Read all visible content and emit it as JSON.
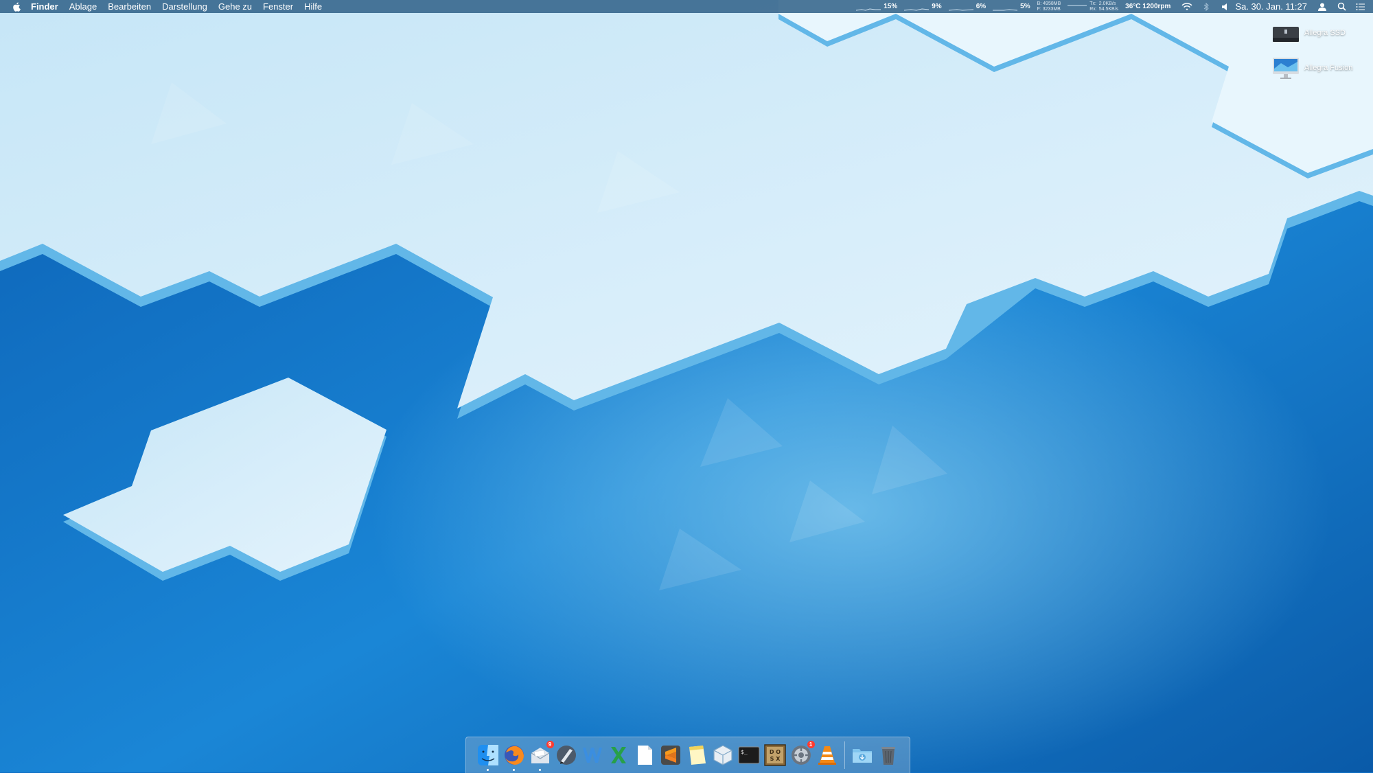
{
  "menubar": {
    "app_name": "Finder",
    "items": [
      "Ablage",
      "Bearbeiten",
      "Darstellung",
      "Gehe zu",
      "Fenster",
      "Hilfe"
    ],
    "status": {
      "cpu1": "15%",
      "cpu2": "9%",
      "gpu": "6%",
      "disk": "5%",
      "memory_lines": [
        "B: 4958MB",
        "F: 3233MB"
      ],
      "network_labels": [
        "Tx:",
        "Rx:"
      ],
      "network_values": [
        "2.0KB/s",
        "54.5KB/s"
      ],
      "temp_fan": "36°C 1200rpm",
      "clock": "Sa. 30. Jan.  11:27"
    }
  },
  "desktop_icons": [
    {
      "label": "Allegra SSD",
      "icon": "hard-drive-icon"
    },
    {
      "label": "Allegra Fusion",
      "icon": "imac-icon"
    }
  ],
  "dock": {
    "apps": [
      {
        "name": "finder",
        "icon": "finder-icon",
        "running": true
      },
      {
        "name": "firefox",
        "icon": "firefox-icon",
        "running": true
      },
      {
        "name": "mail",
        "icon": "mail-icon",
        "running": true,
        "badge": "9"
      },
      {
        "name": "pages",
        "icon": "pen-icon"
      },
      {
        "name": "word",
        "icon": "word-icon"
      },
      {
        "name": "excel",
        "icon": "excel-icon"
      },
      {
        "name": "textedit",
        "icon": "document-icon"
      },
      {
        "name": "sublime",
        "icon": "sublime-icon"
      },
      {
        "name": "notes",
        "icon": "notes-icon"
      },
      {
        "name": "virtualbox",
        "icon": "virtualbox-icon"
      },
      {
        "name": "terminal",
        "icon": "terminal-icon"
      },
      {
        "name": "dosbox",
        "icon": "dosbox-icon"
      },
      {
        "name": "system-preferences",
        "icon": "gear-icon",
        "badge": "1"
      },
      {
        "name": "vlc",
        "icon": "vlc-icon"
      }
    ],
    "downloads": {
      "icon": "downloads-folder-icon"
    },
    "trash": {
      "icon": "trash-icon"
    }
  },
  "colors": {
    "sea": "#0f6fc4",
    "ice": "#dcefff",
    "ice_edge": "#62b7e8"
  }
}
